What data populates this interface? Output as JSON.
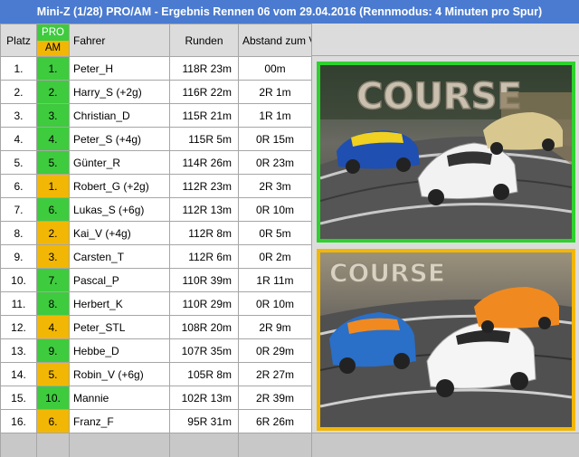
{
  "title": "Mini-Z (1/28) PRO/AM - Ergebnis Rennen 06 vom 29.04.2016 (Rennmodus: 4 Minuten pro Spur)",
  "headers": {
    "platz": "Platz",
    "pro": "PRO",
    "am": "AM",
    "fahrer": "Fahrer",
    "runden": "Runden",
    "abstand": "Abstand zum Vordermann"
  },
  "colors": {
    "title_bg": "#4a7bd0",
    "pro": "#3ecb3e",
    "am": "#f2b705"
  },
  "rows": [
    {
      "platz": "1.",
      "cls": "pro",
      "clsrank": "1.",
      "fahrer": "Peter_H",
      "runden": "118R 23m",
      "abstand": "00m"
    },
    {
      "platz": "2.",
      "cls": "pro",
      "clsrank": "2.",
      "fahrer": "Harry_S (+2g)",
      "runden": "116R 22m",
      "abstand": "2R 1m"
    },
    {
      "platz": "3.",
      "cls": "pro",
      "clsrank": "3.",
      "fahrer": "Christian_D",
      "runden": "115R 21m",
      "abstand": "1R 1m"
    },
    {
      "platz": "4.",
      "cls": "pro",
      "clsrank": "4.",
      "fahrer": "Peter_S (+4g)",
      "runden": "115R 5m",
      "abstand": "0R 15m"
    },
    {
      "platz": "5.",
      "cls": "pro",
      "clsrank": "5.",
      "fahrer": "Günter_R",
      "runden": "114R 26m",
      "abstand": "0R 23m"
    },
    {
      "platz": "6.",
      "cls": "am",
      "clsrank": "1.",
      "fahrer": "Robert_G (+2g)",
      "runden": "112R 23m",
      "abstand": "2R 3m"
    },
    {
      "platz": "7.",
      "cls": "pro",
      "clsrank": "6.",
      "fahrer": "Lukas_S (+6g)",
      "runden": "112R 13m",
      "abstand": "0R 10m"
    },
    {
      "platz": "8.",
      "cls": "am",
      "clsrank": "2.",
      "fahrer": "Kai_V (+4g)",
      "runden": "112R 8m",
      "abstand": "0R 5m"
    },
    {
      "platz": "9.",
      "cls": "am",
      "clsrank": "3.",
      "fahrer": "Carsten_T",
      "runden": "112R 6m",
      "abstand": "0R 2m"
    },
    {
      "platz": "10.",
      "cls": "pro",
      "clsrank": "7.",
      "fahrer": "Pascal_P",
      "runden": "110R 39m",
      "abstand": "1R 11m"
    },
    {
      "platz": "11.",
      "cls": "pro",
      "clsrank": "8.",
      "fahrer": "Herbert_K",
      "runden": "110R 29m",
      "abstand": "0R 10m"
    },
    {
      "platz": "12.",
      "cls": "am",
      "clsrank": "4.",
      "fahrer": "Peter_STL",
      "runden": "108R 20m",
      "abstand": "2R 9m"
    },
    {
      "platz": "13.",
      "cls": "pro",
      "clsrank": "9.",
      "fahrer": "Hebbe_D",
      "runden": "107R 35m",
      "abstand": "0R 29m"
    },
    {
      "platz": "14.",
      "cls": "am",
      "clsrank": "5.",
      "fahrer": "Robin_V (+6g)",
      "runden": "105R 8m",
      "abstand": "2R 27m"
    },
    {
      "platz": "15.",
      "cls": "pro",
      "clsrank": "10.",
      "fahrer": "Mannie",
      "runden": "102R 13m",
      "abstand": "2R 39m"
    },
    {
      "platz": "16.",
      "cls": "am",
      "clsrank": "6.",
      "fahrer": "Franz_F",
      "runden": "95R 31m",
      "abstand": "6R 26m"
    }
  ],
  "photos": [
    {
      "sign": "COURSE",
      "frame": "green"
    },
    {
      "sign": "COURSE",
      "frame": "orange"
    }
  ]
}
